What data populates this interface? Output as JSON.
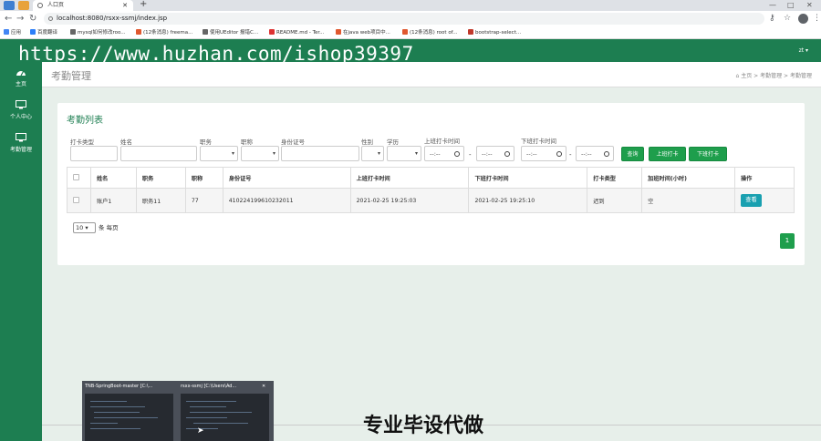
{
  "browser": {
    "tab_title": "人口页",
    "new_tab": "+",
    "url": "localhost:8080/rsxx-ssmj/index.jsp",
    "win_min": "—",
    "win_max": "□",
    "win_close": "✕",
    "bookmarks": [
      "应用",
      "百度翻译",
      "mysql如何修改roo...",
      "(12条消息) freema...",
      "使用UEditor 报错C...",
      "README.md - Ter...",
      "在java web项目中...",
      "(12条消息) root of...",
      "bootstrap-select..."
    ]
  },
  "watermark": "https://www.huzhan.com/ishop39397",
  "header": {
    "user": "zt ▾"
  },
  "sidebar": {
    "items": [
      {
        "label": "主页",
        "icon": "dashboard-icon"
      },
      {
        "label": "个人中心",
        "icon": "monitor-icon"
      },
      {
        "label": "考勤管理",
        "icon": "monitor-icon"
      }
    ]
  },
  "page": {
    "title": "考勤管理",
    "breadcrumb": [
      "主页",
      "考勤管理",
      "考勤管理"
    ],
    "breadcrumb_sep": ">",
    "panel_title": "考勤列表"
  },
  "filters": {
    "labels": {
      "type": "打卡类型",
      "name": "姓名",
      "post": "职务",
      "title": "职称",
      "idcard": "身份证号",
      "gender": "性别",
      "edu": "学历",
      "on_time": "上班打卡时间",
      "off_time": "下班打卡时间"
    },
    "time_placeholder": "--:--",
    "range_sep": "-"
  },
  "buttons": {
    "search": "查询",
    "clock_in": "上班打卡",
    "clock_out": "下班打卡",
    "view": "查看"
  },
  "table": {
    "headers": [
      "",
      "姓名",
      "职务",
      "职称",
      "身份证号",
      "上班打卡时间",
      "下班打卡时间",
      "打卡类型",
      "加班时间(小时)",
      "操作"
    ],
    "rows": [
      {
        "name": "账户1",
        "post": "职务11",
        "title": "77",
        "idcard": "410224199610232011",
        "on": "2021-02-25 19:25:03",
        "off": "2021-02-25 19:25:10",
        "type": "迟到",
        "overtime": "空"
      }
    ]
  },
  "pagination": {
    "page_size": "10",
    "per_page_suffix": "条 每页",
    "current_page": "1"
  },
  "taskbar_previews": [
    {
      "title": "TNB-SpringBoot-master [C:\\..."
    },
    {
      "title": "rsxx-ssmj [C:\\Users\\Ad..."
    }
  ],
  "preview_close": "✕",
  "ad_text": "专业毕设代做",
  "colors": {
    "primary": "#1d7e51",
    "button": "#1e9e4c",
    "info": "#19a0b0",
    "background": "#e7efea"
  }
}
